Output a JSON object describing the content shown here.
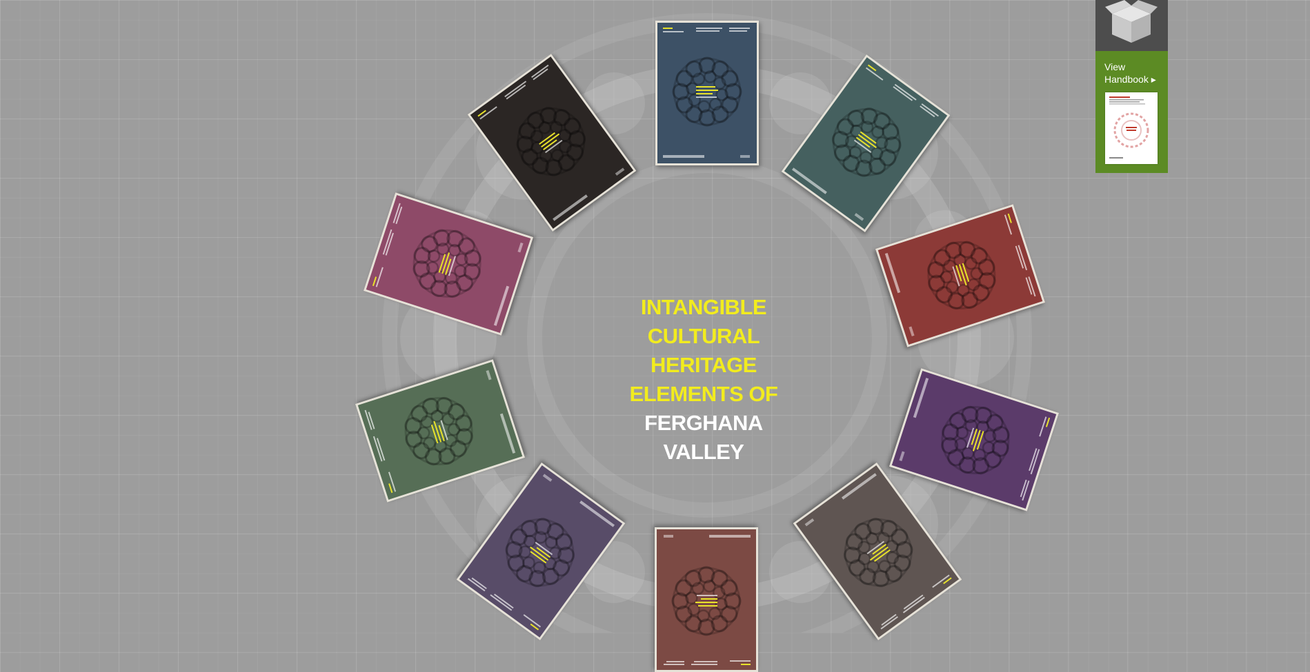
{
  "center_title": {
    "line1": "INTANGIBLE",
    "line2": "CULTURAL",
    "line3": "HERITAGE",
    "line4": "ELEMENTS OF",
    "line5": "FERGHANA",
    "line6": "VALLEY"
  },
  "handbook": {
    "label_line1": "View",
    "label_line2": "Handbook ▸",
    "icon": "open-box-icon"
  },
  "booklets": [
    {
      "color": "#3d5166"
    },
    {
      "color": "#45605f"
    },
    {
      "color": "#8c3a37"
    },
    {
      "color": "#5b3b6a"
    },
    {
      "color": "#5f5552"
    },
    {
      "color": "#7c4a44"
    },
    {
      "color": "#584c68"
    },
    {
      "color": "#566e56"
    },
    {
      "color": "#8e4a68"
    },
    {
      "color": "#2b2624"
    }
  ],
  "colors": {
    "background": "#9d9d9d",
    "title_yellow": "#f2ec1e",
    "title_white": "#ffffff",
    "handbook_green": "#5c8b24",
    "handbook_dark": "#4d4d4d"
  }
}
